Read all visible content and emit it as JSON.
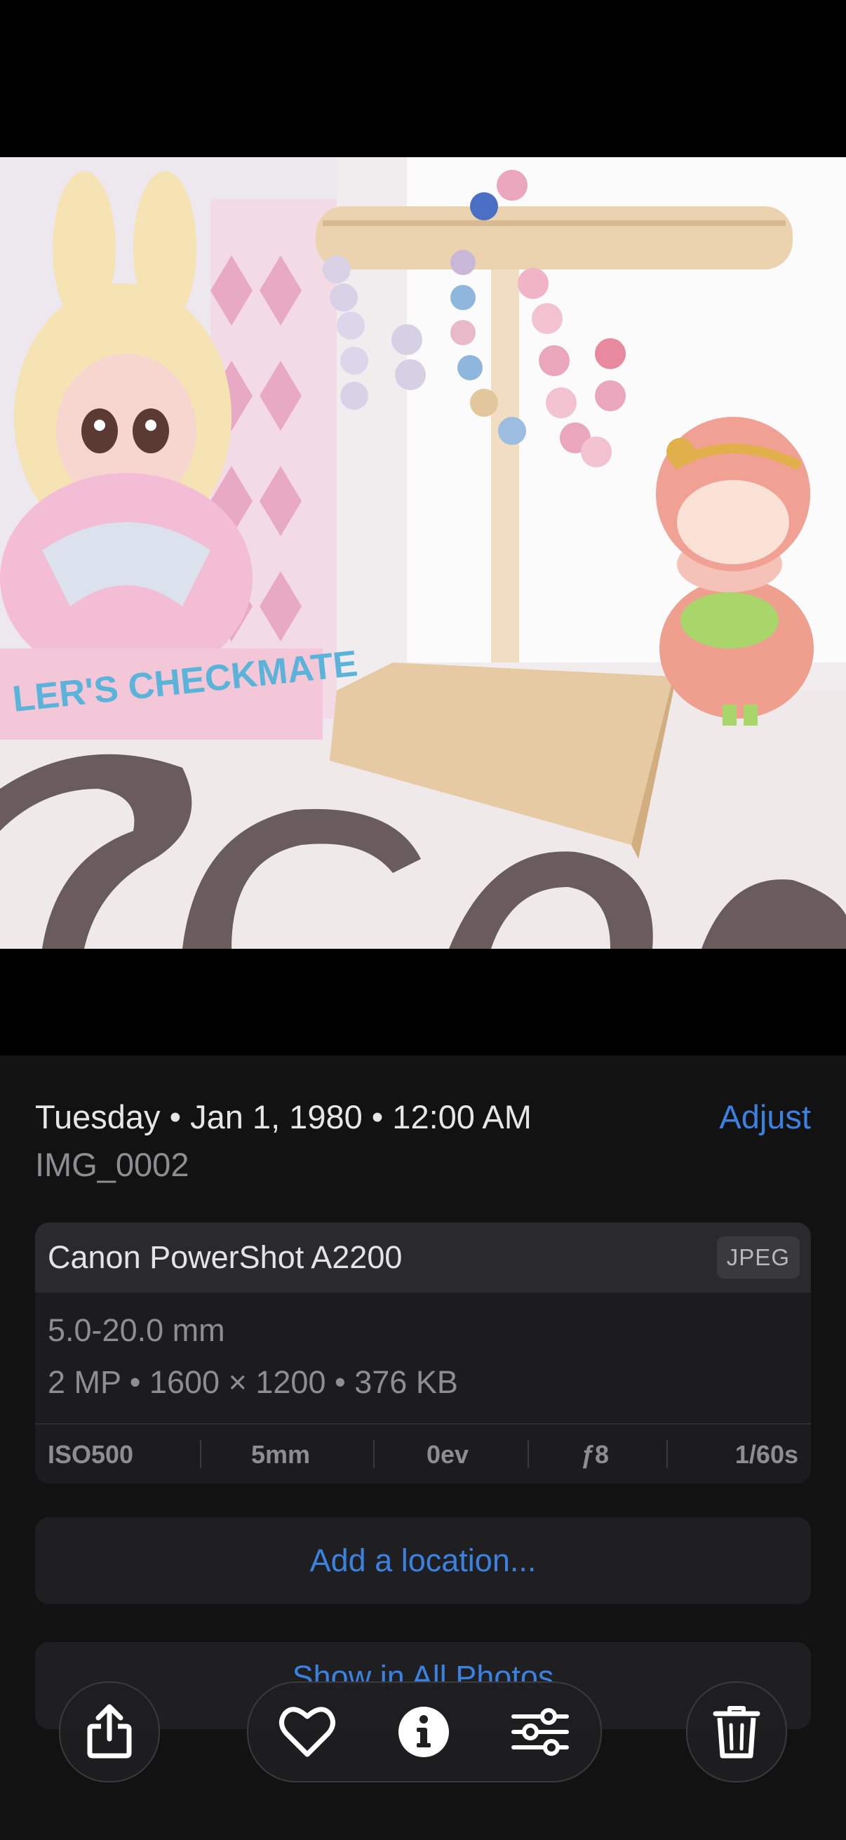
{
  "photo_info": {
    "date_line": "Tuesday • Jan 1, 1980 • 12:00 AM",
    "adjust_label": "Adjust",
    "filename": "IMG_0002"
  },
  "camera": {
    "model": "Canon PowerShot A2200",
    "format": "JPEG",
    "lens": "5.0-20.0 mm",
    "specs": "2 MP • 1600 × 1200 • 376 KB",
    "exif": {
      "iso": "ISO500",
      "focal_length": "5mm",
      "exposure": "0ev",
      "aperture": "ƒ8",
      "shutter": "1/60s"
    }
  },
  "actions": {
    "add_location": "Add a location...",
    "show_in_all_photos": "Show in All Photos"
  },
  "toolbar": {
    "share_icon": "share-icon",
    "favorite_icon": "heart-icon",
    "info_icon": "info-icon",
    "edit_icon": "sliders-icon",
    "delete_icon": "trash-icon"
  },
  "colors": {
    "accent": "#3b82e0",
    "sheet_background": "#121212",
    "card_background": "#1c1c1e"
  }
}
